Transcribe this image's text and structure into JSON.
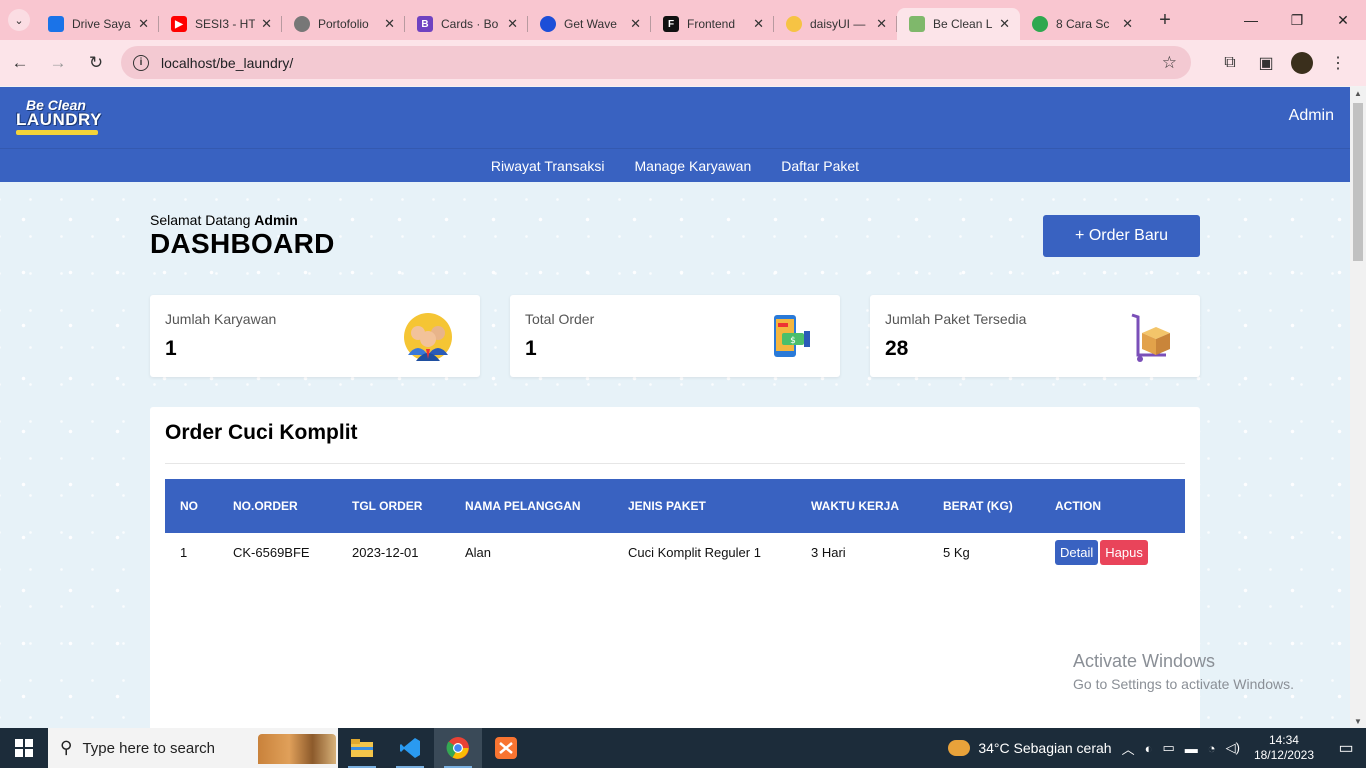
{
  "browser": {
    "tabs": [
      {
        "title": "Drive Saya",
        "favicon_color": "#1a73e8"
      },
      {
        "title": "SESI3 - HT",
        "favicon_color": "#ff0000"
      },
      {
        "title": "Portofolio",
        "favicon_color": "#555555"
      },
      {
        "title": "Cards · Bo",
        "favicon_color": "#6f42c1",
        "favicon_text": "B"
      },
      {
        "title": "Get Wave",
        "favicon_color": "#1c4ed8"
      },
      {
        "title": "Frontend",
        "favicon_color": "#111111",
        "favicon_text": "F"
      },
      {
        "title": "daisyUI —",
        "favicon_color": "#f6c344"
      },
      {
        "title": "Be Clean L",
        "favicon_color": "#7fb86b",
        "active": true
      },
      {
        "title": "8 Cara Sc",
        "favicon_color": "#2fa84f"
      }
    ],
    "url": "localhost/be_laundry/"
  },
  "site": {
    "logo_line1": "Be Clean",
    "logo_line2": "LAUNDRY",
    "user": "Admin",
    "nav": [
      "Riwayat Transaksi",
      "Manage Karyawan",
      "Daftar Paket"
    ]
  },
  "dashboard": {
    "welcome_prefix": "Selamat Datang",
    "welcome_name": "Admin",
    "title": "DASHBOARD",
    "order_button": "+ Order Baru",
    "cards": [
      {
        "label": "Jumlah Karyawan",
        "value": "1",
        "icon": "employees-icon"
      },
      {
        "label": "Total Order",
        "value": "1",
        "icon": "mobile-payment-icon"
      },
      {
        "label": "Jumlah Paket Tersedia",
        "value": "28",
        "icon": "package-trolley-icon"
      }
    ]
  },
  "orders": {
    "title": "Order Cuci Komplit",
    "columns": [
      "NO",
      "NO.ORDER",
      "TGL ORDER",
      "NAMA PELANGGAN",
      "JENIS PAKET",
      "WAKTU KERJA",
      "BERAT (KG)",
      "ACTION"
    ],
    "rows": [
      {
        "no": "1",
        "order": "CK-6569BFE",
        "date": "2023-12-01",
        "customer": "Alan",
        "package": "Cuci Komplit Reguler 1",
        "duration": "3 Hari",
        "weight": "5 Kg"
      }
    ],
    "detail_label": "Detail",
    "delete_label": "Hapus"
  },
  "overlay": {
    "line1": "Activate Windows",
    "line2": "Go to Settings to activate Windows."
  },
  "taskbar": {
    "search_placeholder": "Type here to search",
    "weather": "34°C  Sebagian cerah",
    "time": "14:34",
    "date": "18/12/2023"
  },
  "colors": {
    "primary": "#3962c1",
    "danger": "#e9445a",
    "tabstrip": "#f9c6d0"
  }
}
